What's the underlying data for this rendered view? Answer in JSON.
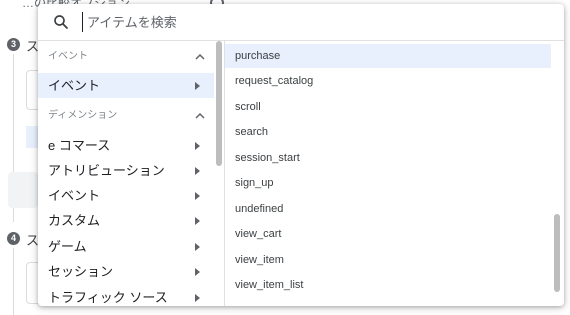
{
  "background": {
    "top_text": "…の比較オプション",
    "steps": [
      {
        "number": "3",
        "label_fragment": "ス"
      },
      {
        "number": "4",
        "label_fragment": "ス"
      }
    ]
  },
  "dropdown": {
    "search": {
      "placeholder": "アイテムを検索",
      "value": ""
    },
    "categories": {
      "event_header": "イベント",
      "event_items": [
        {
          "label": "イベント",
          "selected": true
        }
      ],
      "dimension_header": "ディメンション",
      "dimension_items": [
        {
          "label": "e コマース"
        },
        {
          "label": "アトリビューション"
        },
        {
          "label": "イベント"
        },
        {
          "label": "カスタム"
        },
        {
          "label": "ゲーム"
        },
        {
          "label": "セッション"
        },
        {
          "label": "トラフィック ソース"
        }
      ]
    },
    "events": [
      {
        "label": "purchase",
        "selected": true
      },
      {
        "label": "request_catalog"
      },
      {
        "label": "scroll"
      },
      {
        "label": "search"
      },
      {
        "label": "session_start"
      },
      {
        "label": "sign_up"
      },
      {
        "label": "undefined"
      },
      {
        "label": "view_cart"
      },
      {
        "label": "view_item"
      },
      {
        "label": "view_item_list"
      }
    ]
  },
  "icons": {
    "search": "search-icon",
    "collapse": "chevron-up-icon",
    "expand": "triangle-right-icon"
  },
  "colors": {
    "selected_bg": "#e8f0fe",
    "text": "#202124",
    "muted": "#80868b"
  }
}
